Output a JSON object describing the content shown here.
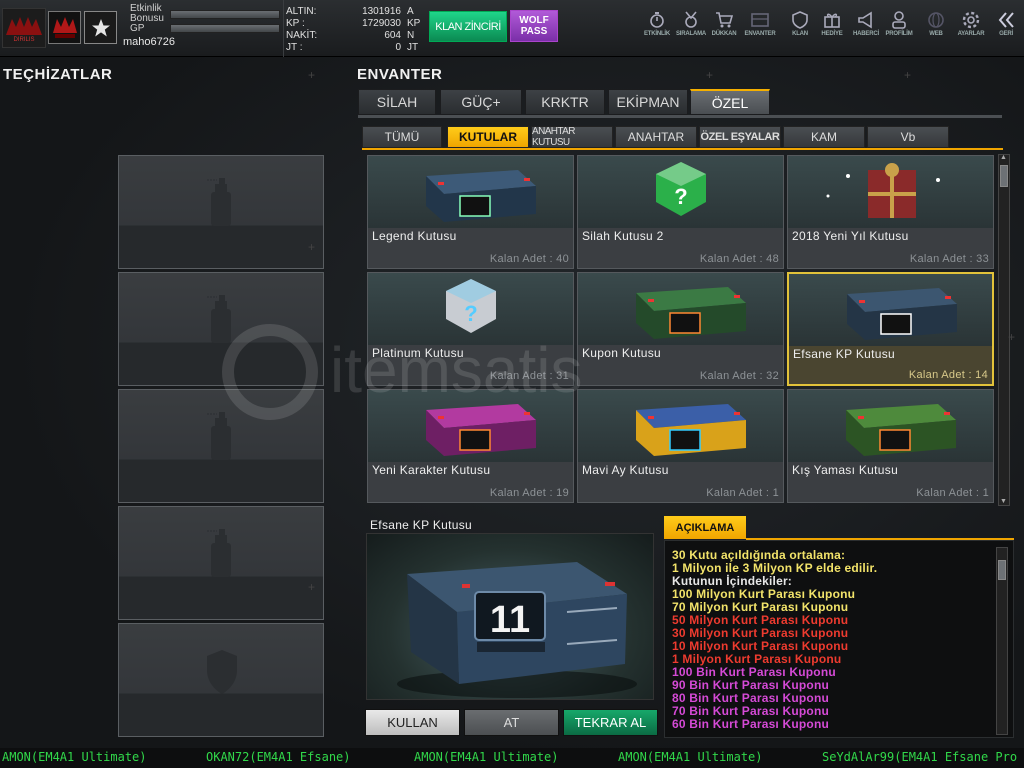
{
  "profile": {
    "etkinlik_label": "Etkinlik",
    "bonusu_label": "Bonusu",
    "gp_label": "GP",
    "username": "maho6726",
    "logo_text": "WOLF",
    "logo_sub": "DIRILIS"
  },
  "currency": [
    {
      "label": "ALTIN:",
      "value": "1301916",
      "unit": "A"
    },
    {
      "label": "KP   :",
      "value": "1729030",
      "unit": "KP"
    },
    {
      "label": "NAKİT:",
      "value": "604",
      "unit": "N"
    },
    {
      "label": "JT   :",
      "value": "0",
      "unit": "JT"
    }
  ],
  "klan_button": "KLAN ZİNCİRİ",
  "wolf_pass": {
    "line1": "WOLF",
    "line2": "PASS"
  },
  "nav": [
    {
      "label": "ETKİNLİK",
      "icon": "stopwatch-icon"
    },
    {
      "label": "SIRALAMA",
      "icon": "rank-medal-icon"
    },
    {
      "label": "DÜKKAN",
      "icon": "cart-icon"
    },
    {
      "label": "ENVANTER",
      "icon": "inventory-icon"
    },
    {
      "label": "KLAN",
      "icon": "shield-icon"
    },
    {
      "label": "HEDİYE",
      "icon": "gift-icon"
    },
    {
      "label": "HABERCİ",
      "icon": "megaphone-icon"
    },
    {
      "label": "PROFİLİM",
      "icon": "profile-icon"
    },
    {
      "label": "WEB",
      "icon": "globe-icon"
    },
    {
      "label": "AYARLAR",
      "icon": "gear-icon"
    },
    {
      "label": "GERİ",
      "icon": "back-icon"
    }
  ],
  "left_title": "TEÇHİZATLAR",
  "inventory_title": "ENVANTER",
  "tabs": [
    "SİLAH",
    "GÜÇ+",
    "KRKTR",
    "EKİPMAN",
    "ÖZEL"
  ],
  "subtabs": [
    "TÜMÜ",
    "KUTULAR",
    "ANAHTAR KUTUSU",
    "ANAHTAR",
    "ÖZEL EŞYALAR",
    "KAM",
    "Vb"
  ],
  "items": [
    {
      "name": "Legend Kutusu",
      "count": "Kalan Adet : 40"
    },
    {
      "name": "Silah Kutusu 2",
      "count": "Kalan Adet : 48"
    },
    {
      "name": "2018 Yeni Yıl Kutusu",
      "count": "Kalan Adet : 33"
    },
    {
      "name": "Platinum Kutusu",
      "count": "Kalan Adet : 31"
    },
    {
      "name": "Kupon Kutusu",
      "count": "Kalan Adet : 32"
    },
    {
      "name": "Efsane KP Kutusu",
      "count": "Kalan Adet : 14"
    },
    {
      "name": "Yeni Karakter Kutusu",
      "count": "Kalan Adet : 19"
    },
    {
      "name": "Mavi Ay Kutusu",
      "count": "Kalan Adet : 1"
    },
    {
      "name": "Kış Yaması Kutusu",
      "count": "Kalan Adet : 1"
    }
  ],
  "detail": {
    "name": "Efsane KP Kutusu",
    "box_number": "11"
  },
  "buttons": {
    "use": "KULLAN",
    "drop": "AT",
    "rebuy": "TEKRAR AL"
  },
  "description": {
    "header": "AÇIKLAMA",
    "lines": [
      {
        "text": "30 Kutu açıldığında ortalama:",
        "color": "#f2e36a"
      },
      {
        "text": "1 Milyon ile 3 Milyon KP elde edilir.",
        "color": "#f2e36a"
      },
      {
        "text": "Kutunun İçindekiler:",
        "color": "#e6e6e6"
      },
      {
        "text": "100 Milyon Kurt Parası Kuponu",
        "color": "#f2e36a"
      },
      {
        "text": "70 Milyon Kurt Parası Kuponu",
        "color": "#f2e36a"
      },
      {
        "text": "50 Milyon Kurt Parası Kuponu",
        "color": "#ee3b2f"
      },
      {
        "text": "30 Milyon Kurt Parası Kuponu",
        "color": "#ee3b2f"
      },
      {
        "text": "10 Milyon Kurt Parası Kuponu",
        "color": "#ee3b2f"
      },
      {
        "text": "1 Milyon Kurt Parası Kuponu",
        "color": "#ee3b2f"
      },
      {
        "text": "100 Bin Kurt Parası Kuponu",
        "color": "#d54ad6"
      },
      {
        "text": "90 Bin Kurt Parası Kuponu",
        "color": "#d54ad6"
      },
      {
        "text": "80 Bin Kurt Parası Kuponu",
        "color": "#d54ad6"
      },
      {
        "text": "70 Bin Kurt Parası Kuponu",
        "color": "#d54ad6"
      },
      {
        "text": "60 Bin Kurt Parası Kuponu",
        "color": "#d54ad6"
      }
    ]
  },
  "ticker": [
    "AMON(EM4A1 Ultimate)",
    "OKAN72(EM4A1 Efsane)",
    "AMON(EM4A1 Ultimate)",
    "AMON(EM4A1 Ultimate)",
    "SeYdAlAr99(EM4A1 Efsane Pro"
  ],
  "watermark": "itemsatis"
}
